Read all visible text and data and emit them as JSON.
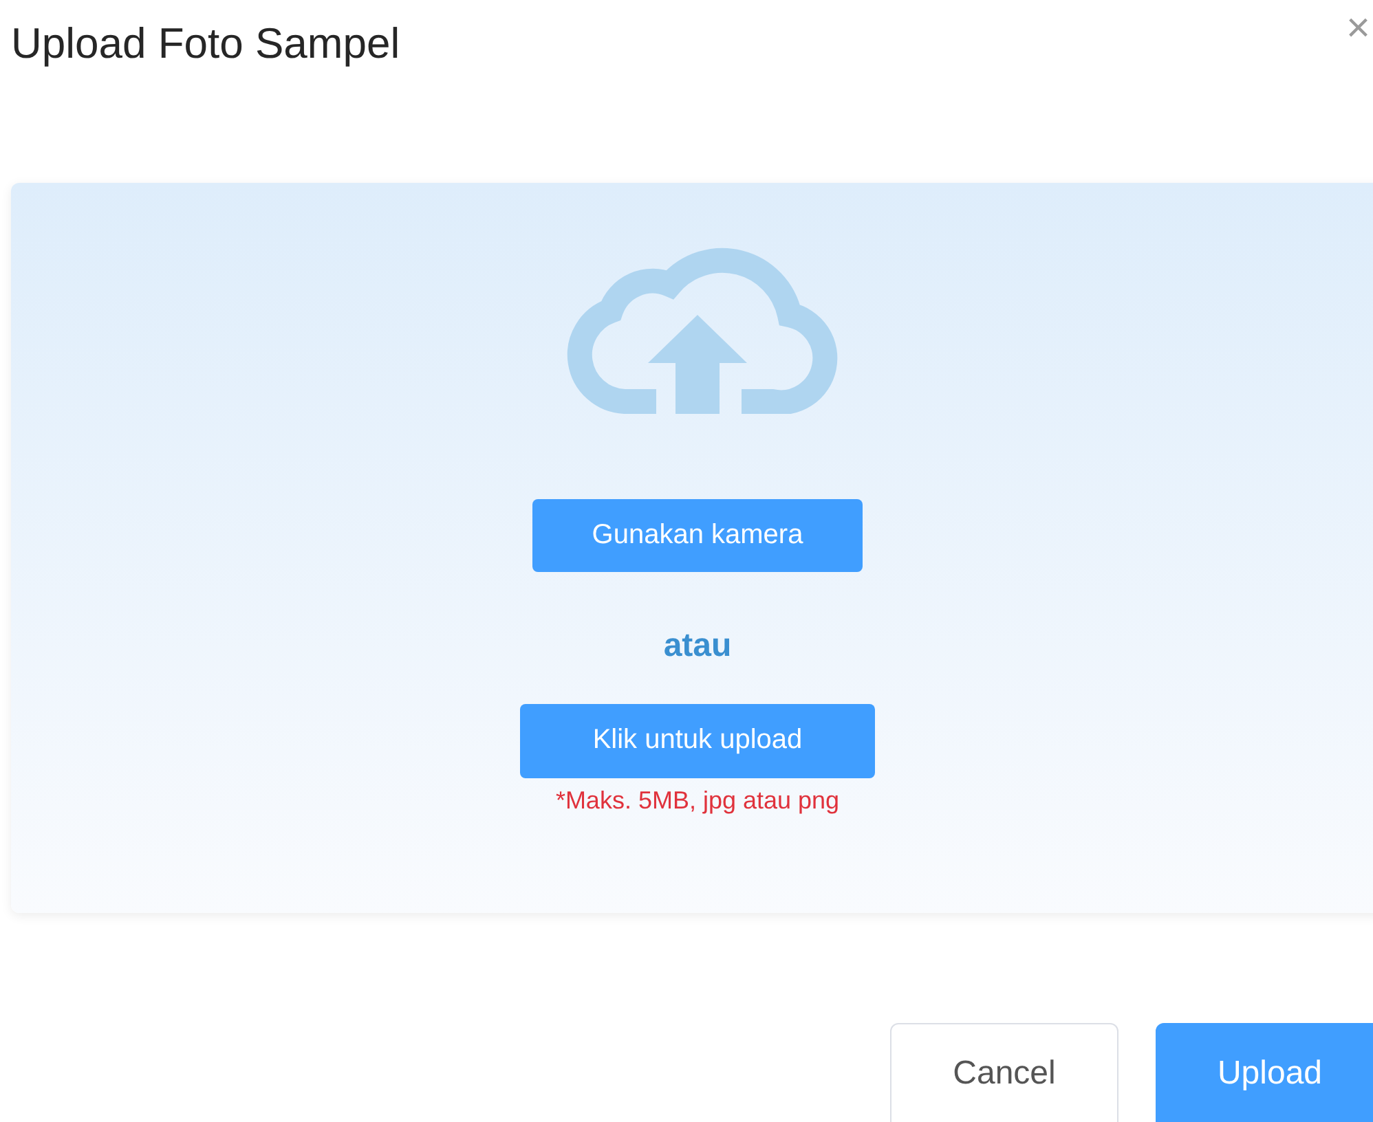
{
  "dialog": {
    "title": "Upload Foto Sampel",
    "close": "×"
  },
  "upload_area": {
    "camera_button": "Gunakan kamera",
    "separator": "atau",
    "upload_button": "Klik untuk upload",
    "note": "*Maks. 5MB, jpg atau png"
  },
  "buttons": [
    {
      "label": "Cancel",
      "kind": "secondary"
    },
    {
      "label": "Upload",
      "kind": "primary"
    }
  ]
}
